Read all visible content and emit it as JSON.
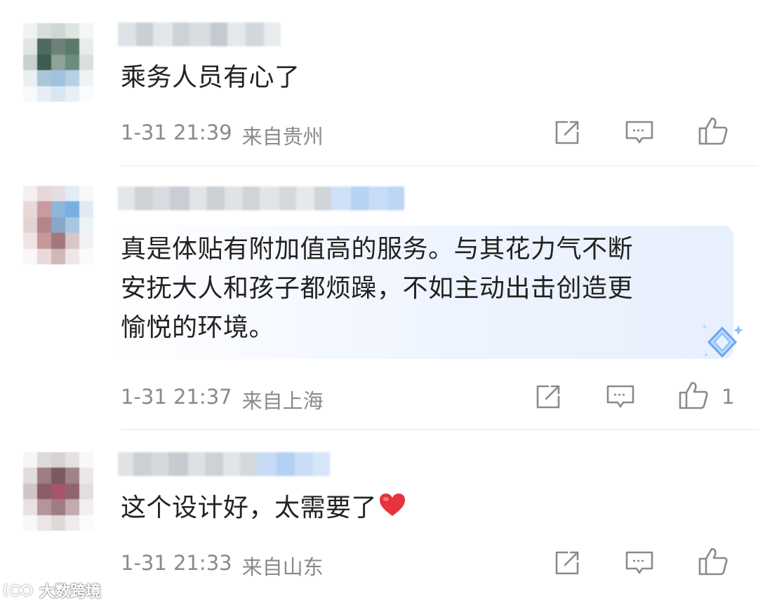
{
  "comments": [
    {
      "text": "乘务人员有心了",
      "date": "1-31 21:39",
      "location": "来自贵州",
      "like_count": ""
    },
    {
      "text_lines": [
        "真是体贴有附加值高的服务。与其花力气不断",
        "安抚大人和孩子都烦躁，不如主动出击创造更",
        "愉悦的环境。"
      ],
      "date": "1-31 21:37",
      "location": "来自上海",
      "like_count": "1"
    },
    {
      "text": "这个设计好，太需要了",
      "emoji": "heart-emoji",
      "date": "1-31 21:33",
      "location": "来自山东",
      "like_count": ""
    }
  ],
  "icons": {
    "share": "share-icon",
    "reply": "comment-icon",
    "like": "like-icon",
    "badge": "diamond-badge-icon"
  },
  "watermark": {
    "text": "大数跨境"
  },
  "colors": {
    "text": "#222222",
    "meta": "#8a8a8a",
    "heart": "#e8323c",
    "bubble": "#eef4ff"
  }
}
